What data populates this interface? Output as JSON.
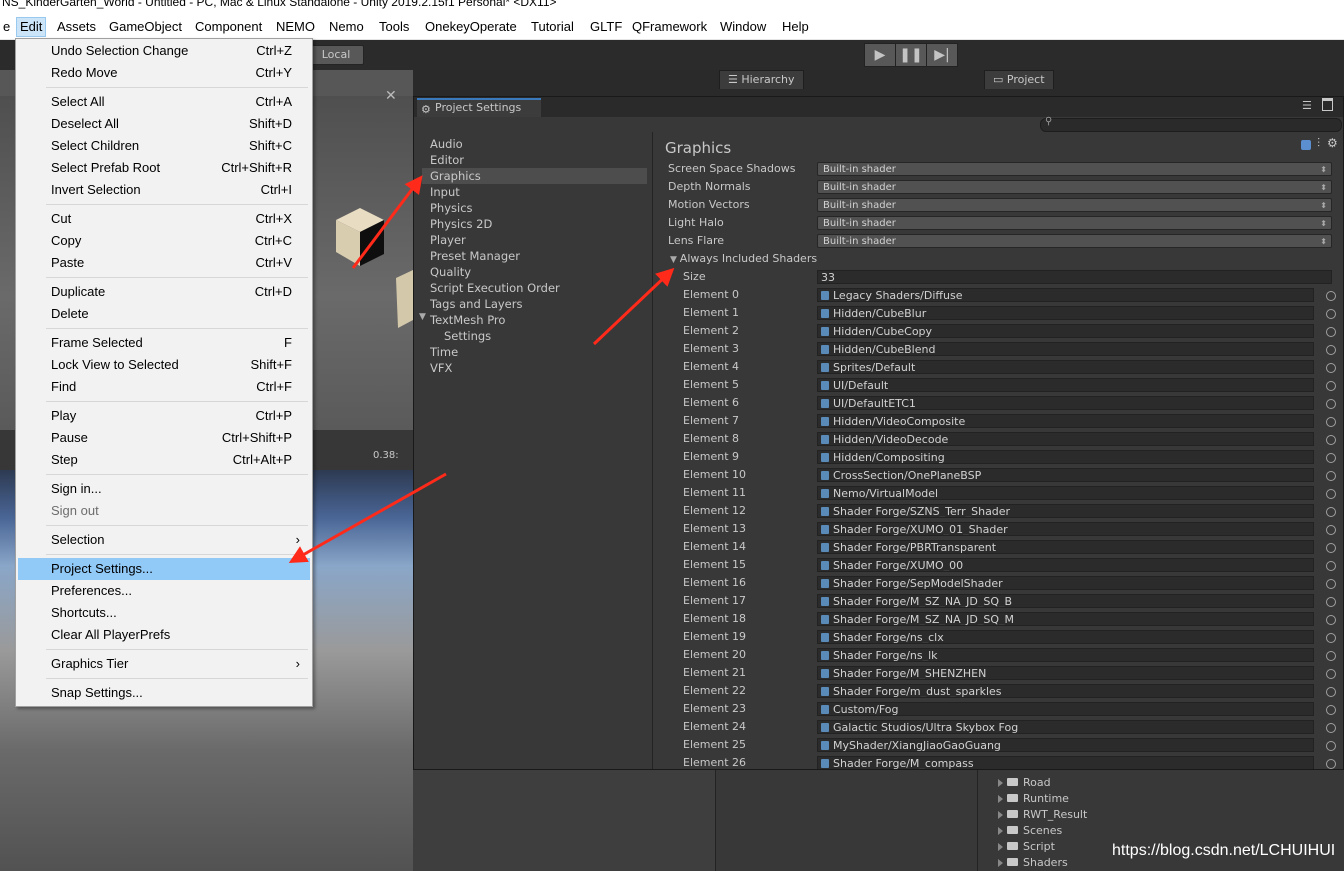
{
  "window": {
    "title": "NS_KinderGarten_World - Untitled - PC, Mac & Linux Standalone - Unity 2019.2.15f1 Personal* <DX11>"
  },
  "menubar": [
    "e",
    "Edit",
    "Assets",
    "GameObject",
    "Component",
    "NEMO",
    "Nemo",
    "Tools",
    "OnekeyOperate",
    "Tutorial",
    "GLTF",
    "QFramework",
    "Window",
    "Help"
  ],
  "toolbar": {
    "local": "Local",
    "play_icon": "play-icon",
    "pause_icon": "pause-icon",
    "step_icon": "step-icon"
  },
  "panels": {
    "hierarchy": "Hierarchy",
    "project": "Project",
    "game_time": "0.38:"
  },
  "edit_menu": [
    {
      "label": "Undo Selection Change",
      "shortcut": "Ctrl+Z"
    },
    {
      "label": "Redo Move",
      "shortcut": "Ctrl+Y"
    },
    {
      "label": "Select All",
      "shortcut": "Ctrl+A"
    },
    {
      "label": "Deselect All",
      "shortcut": "Shift+D"
    },
    {
      "label": "Select Children",
      "shortcut": "Shift+C"
    },
    {
      "label": "Select Prefab Root",
      "shortcut": "Ctrl+Shift+R"
    },
    {
      "label": "Invert Selection",
      "shortcut": "Ctrl+I"
    },
    {
      "label": "Cut",
      "shortcut": "Ctrl+X"
    },
    {
      "label": "Copy",
      "shortcut": "Ctrl+C"
    },
    {
      "label": "Paste",
      "shortcut": "Ctrl+V"
    },
    {
      "label": "Duplicate",
      "shortcut": "Ctrl+D"
    },
    {
      "label": "Delete",
      "shortcut": ""
    },
    {
      "label": "Frame Selected",
      "shortcut": "F"
    },
    {
      "label": "Lock View to Selected",
      "shortcut": "Shift+F"
    },
    {
      "label": "Find",
      "shortcut": "Ctrl+F"
    },
    {
      "label": "Play",
      "shortcut": "Ctrl+P"
    },
    {
      "label": "Pause",
      "shortcut": "Ctrl+Shift+P"
    },
    {
      "label": "Step",
      "shortcut": "Ctrl+Alt+P"
    },
    {
      "label": "Sign in...",
      "shortcut": ""
    },
    {
      "label": "Sign out",
      "shortcut": ""
    },
    {
      "label": "Selection",
      "shortcut": "›"
    },
    {
      "label": "Project Settings...",
      "shortcut": ""
    },
    {
      "label": "Preferences...",
      "shortcut": ""
    },
    {
      "label": "Shortcuts...",
      "shortcut": ""
    },
    {
      "label": "Clear All PlayerPrefs",
      "shortcut": ""
    },
    {
      "label": "Graphics Tier",
      "shortcut": "›"
    },
    {
      "label": "Snap Settings...",
      "shortcut": ""
    }
  ],
  "project_settings": {
    "tab_title": "Project Settings",
    "categories": [
      "Audio",
      "Editor",
      "Graphics",
      "Input",
      "Physics",
      "Physics 2D",
      "Player",
      "Preset Manager",
      "Quality",
      "Script Execution Order",
      "Tags and Layers",
      "TextMesh Pro",
      "Settings",
      "Time",
      "VFX"
    ],
    "selected_category": "Graphics",
    "section_title": "Graphics",
    "shader_settings": [
      {
        "label": "Screen Space Shadows",
        "value": "Built-in shader"
      },
      {
        "label": "Depth Normals",
        "value": "Built-in shader"
      },
      {
        "label": "Motion Vectors",
        "value": "Built-in shader"
      },
      {
        "label": "Light Halo",
        "value": "Built-in shader"
      },
      {
        "label": "Lens Flare",
        "value": "Built-in shader"
      }
    ],
    "always_included": {
      "label": "Always Included Shaders",
      "size_label": "Size",
      "size": "33",
      "elements": [
        {
          "label": "Element 0",
          "value": "Legacy Shaders/Diffuse"
        },
        {
          "label": "Element 1",
          "value": "Hidden/CubeBlur"
        },
        {
          "label": "Element 2",
          "value": "Hidden/CubeCopy"
        },
        {
          "label": "Element 3",
          "value": "Hidden/CubeBlend"
        },
        {
          "label": "Element 4",
          "value": "Sprites/Default"
        },
        {
          "label": "Element 5",
          "value": "UI/Default"
        },
        {
          "label": "Element 6",
          "value": "UI/DefaultETC1"
        },
        {
          "label": "Element 7",
          "value": "Hidden/VideoComposite"
        },
        {
          "label": "Element 8",
          "value": "Hidden/VideoDecode"
        },
        {
          "label": "Element 9",
          "value": "Hidden/Compositing"
        },
        {
          "label": "Element 10",
          "value": "CrossSection/OnePlaneBSP"
        },
        {
          "label": "Element 11",
          "value": "Nemo/VirtualModel"
        },
        {
          "label": "Element 12",
          "value": "Shader Forge/SZNS_Terr_Shader"
        },
        {
          "label": "Element 13",
          "value": "Shader Forge/XUMO_01_Shader"
        },
        {
          "label": "Element 14",
          "value": "Shader Forge/PBRTransparent"
        },
        {
          "label": "Element 15",
          "value": "Shader Forge/XUMO_00"
        },
        {
          "label": "Element 16",
          "value": "Shader Forge/SepModelShader"
        },
        {
          "label": "Element 17",
          "value": "Shader Forge/M_SZ_NA_JD_SQ_B"
        },
        {
          "label": "Element 18",
          "value": "Shader Forge/M_SZ_NA_JD_SQ_M"
        },
        {
          "label": "Element 19",
          "value": "Shader Forge/ns_clx"
        },
        {
          "label": "Element 20",
          "value": "Shader Forge/ns_lk"
        },
        {
          "label": "Element 21",
          "value": "Shader Forge/M_SHENZHEN"
        },
        {
          "label": "Element 22",
          "value": "Shader Forge/m_dust_sparkles"
        },
        {
          "label": "Element 23",
          "value": "Custom/Fog"
        },
        {
          "label": "Element 24",
          "value": "Galactic Studios/Ultra Skybox Fog"
        },
        {
          "label": "Element 25",
          "value": "MyShader/XiangJiaoGaoGuang"
        },
        {
          "label": "Element 26",
          "value": "Shader Forge/M_compass"
        }
      ]
    }
  },
  "project_folders": [
    "Road",
    "Runtime",
    "RWT_Result",
    "Scenes",
    "Script",
    "Shaders"
  ],
  "watermark": "https://blog.csdn.net/LCHUIHUI",
  "colors": {
    "highlight": "#91c9f7",
    "arrow": "#ff2a1a",
    "tab_accent": "#3a79bb"
  }
}
